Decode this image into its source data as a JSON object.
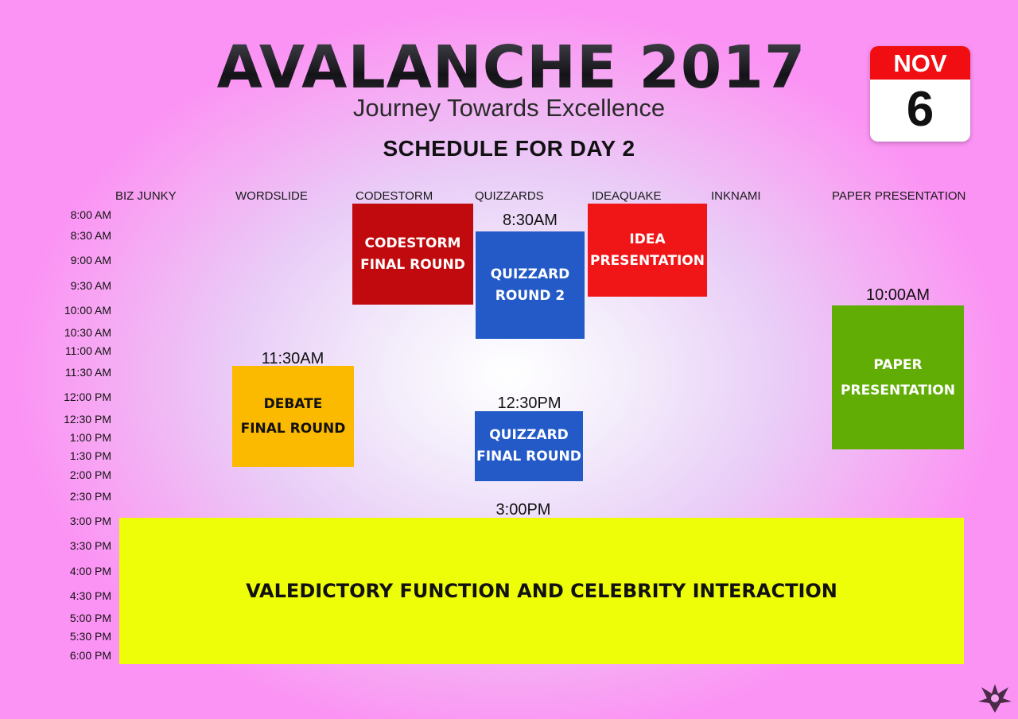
{
  "header": {
    "title": "AVALANCHE 2017",
    "tagline": "Journey Towards Excellence",
    "schedule_heading": "SCHEDULE FOR DAY 2"
  },
  "calendar": {
    "month": "NOV",
    "day": "6"
  },
  "columns": [
    "BIZ JUNKY",
    "WORDSLIDE",
    "CODESTORM",
    "QUIZZARDS",
    "IDEAQUAKE",
    "INKNAMI",
    "PAPER PRESENTATION"
  ],
  "times": [
    "8:00 AM",
    "8:30 AM",
    "9:00 AM",
    "9:30 AM",
    "10:00 AM",
    "10:30 AM",
    "11:00 AM",
    "11:30 AM",
    "12:00 PM",
    "12:30 PM",
    "1:00 PM",
    "1:30 PM",
    "2:00 PM",
    "2:30 PM",
    "3:00 PM",
    "3:30 PM",
    "4:00 PM",
    "4:30 PM",
    "5:00 PM",
    "5:30 PM",
    "6:00 PM"
  ],
  "events": {
    "codestorm": {
      "label": "CODESTORM\nFINAL ROUND",
      "color": "#c00a0d"
    },
    "quizzard_round2": {
      "label": "QUIZZARD\nROUND 2",
      "start": "8:30AM",
      "color": "#235ac8"
    },
    "idea_presentation": {
      "label": "IDEA\nPRESENTATION",
      "color": "#f01517"
    },
    "paper_presentation": {
      "label": "PAPER\nPRESENTATION",
      "start": "10:00AM",
      "color": "#62ad05"
    },
    "debate_final": {
      "label": "DEBATE\nFINAL ROUND",
      "start": "11:30AM",
      "color": "#fbb900"
    },
    "quizzard_final": {
      "label": "QUIZZARD\nFINAL ROUND",
      "start": "12:30PM",
      "color": "#235ac8"
    },
    "valedictory": {
      "label": "VALEDICTORY FUNCTION AND CELEBRITY INTERACTION",
      "start": "3:00PM",
      "color": "#eefd08"
    }
  }
}
